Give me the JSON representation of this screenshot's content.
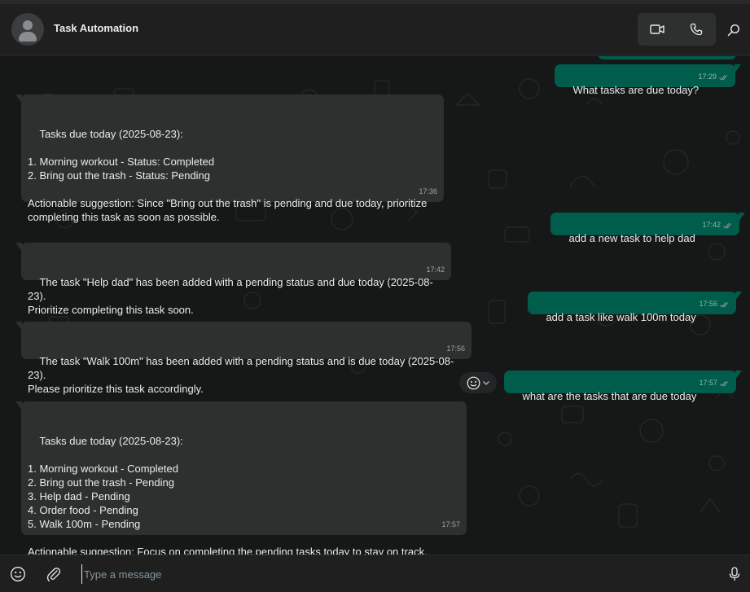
{
  "header": {
    "title": "Task Automation",
    "icons": [
      "video-call-icon",
      "voice-call-icon",
      "search-icon"
    ]
  },
  "colors": {
    "incoming_bubble": "#2e2f2f",
    "outgoing_bubble": "#005c4b",
    "chat_background": "#161717",
    "tick_color": "#8696a0"
  },
  "messages": [
    {
      "direction": "out",
      "text": "What tasks are due today?",
      "time": "17:29"
    },
    {
      "direction": "in",
      "text": "Tasks due today (2025-08-23):\n\n1. Morning workout - Status: Completed\n2. Bring out the trash - Status: Pending\n\nActionable suggestion: Since \"Bring out the trash\" is pending and due today, prioritize\ncompleting this task as soon as possible.",
      "time": "17:36"
    },
    {
      "direction": "out",
      "text": "add a new task to help dad",
      "time": "17:42"
    },
    {
      "direction": "in",
      "text": "The task \"Help dad\" has been added with a pending status and due today (2025-08-23).\nPrioritize completing this task soon.",
      "time": "17:42"
    },
    {
      "direction": "out",
      "text": "add a task like walk 100m today",
      "time": "17:56"
    },
    {
      "direction": "in",
      "text": "The task \"Walk 100m\" has been added with a pending status and is due today (2025-08-23).\nPlease prioritize this task accordingly.",
      "time": "17:56"
    },
    {
      "direction": "out",
      "text": "what are the tasks that are due today",
      "time": "17:57"
    },
    {
      "direction": "in",
      "text": "Tasks due today (2025-08-23):\n\n1. Morning workout - Completed\n2. Bring out the trash - Pending\n3. Help dad - Pending\n4. Order food - Pending\n5. Walk 100m - Pending\n\nActionable suggestion: Focus on completing the pending tasks today to stay on track.",
      "time": "17:57"
    }
  ],
  "composer": {
    "placeholder": "Type a message",
    "value": ""
  }
}
